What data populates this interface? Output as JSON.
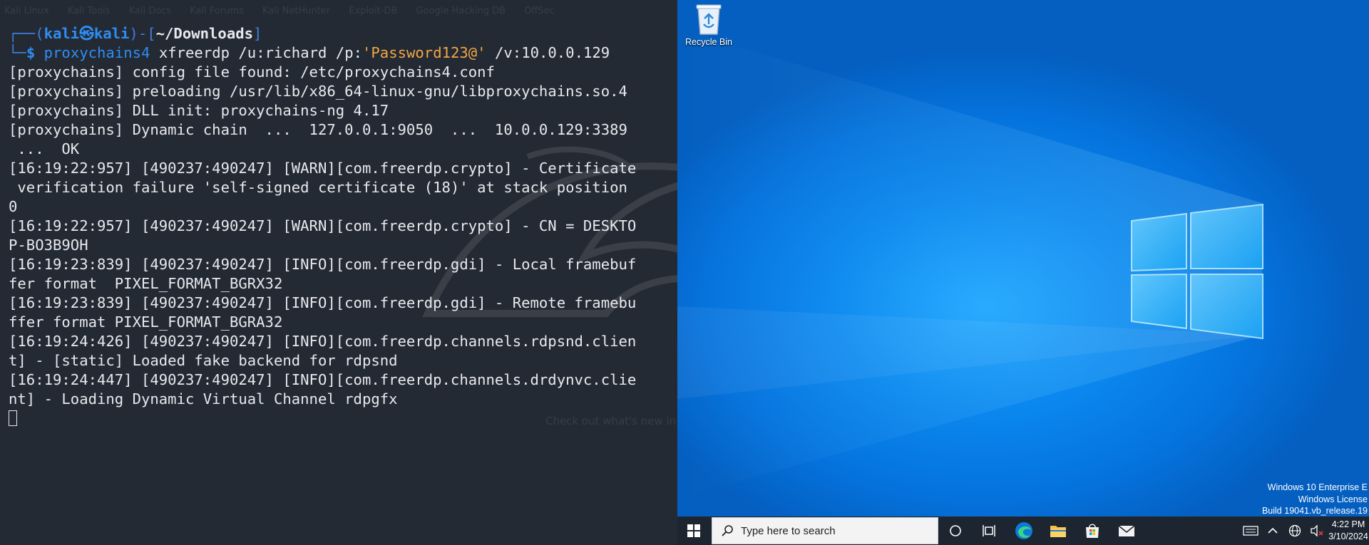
{
  "terminal": {
    "bookmarks": [
      "Kali Linux",
      "Kali Tools",
      "Kali Docs",
      "Kali Forums",
      "Kali NetHunter",
      "Exploit-DB",
      "Google Hacking DB",
      "OffSec"
    ],
    "prompt": {
      "top_open": "┌──(",
      "user": "kali",
      "at": "㉿",
      "host": "kali",
      "mid": ")-[",
      "path": "~/Downloads",
      "close": "]",
      "bottom": "└─",
      "dollar": "$"
    },
    "command": {
      "name": "proxychains4",
      "args_before": " xfreerdp /u:richard /p:",
      "password": "'Password123@'",
      "args_after": " /v:10.0.0.129"
    },
    "output": [
      "[proxychains] config file found: /etc/proxychains4.conf",
      "[proxychains] preloading /usr/lib/x86_64-linux-gnu/libproxychains.so.4",
      "[proxychains] DLL init: proxychains-ng 4.17",
      "[proxychains] Dynamic chain  ...  127.0.0.1:9050  ...  10.0.0.129:3389",
      " ...  OK",
      "[16:19:22:957] [490237:490247] [WARN][com.freerdp.crypto] - Certificate",
      " verification failure 'self-signed certificate (18)' at stack position",
      "0",
      "[16:19:22:957] [490237:490247] [WARN][com.freerdp.crypto] - CN = DESKTO",
      "P-BO3B9OH",
      "[16:19:23:839] [490237:490247] [INFO][com.freerdp.gdi] - Local framebuf",
      "fer format  PIXEL_FORMAT_BGRX32",
      "[16:19:23:839] [490237:490247] [INFO][com.freerdp.gdi] - Remote framebu",
      "ffer format PIXEL_FORMAT_BGRA32",
      "[16:19:24:426] [490237:490247] [INFO][com.freerdp.channels.rdpsnd.clien",
      "t] - [static] Loaded fake backend for rdpsnd",
      "[16:19:24:447] [490237:490247] [INFO][com.freerdp.channels.drdynvc.clie",
      "nt] - Loading Dynamic Virtual Channel rdpgfx"
    ],
    "background_faded_text": "Check out what's new in Kali"
  },
  "desktop": {
    "recycle_bin_label": "Recycle Bin",
    "watermark": [
      "Windows 10 Enterprise E",
      "Windows License",
      "Build 19041.vb_release.19"
    ],
    "taskbar": {
      "search_placeholder": "Type here to search",
      "time": "4:22 PM",
      "date": "3/10/2024"
    }
  },
  "colors": {
    "terminal_bg": "#242a33",
    "prompt_blue": "#2f8df4",
    "string_orange": "#f0a646",
    "desktop_blue": "#0a88ef",
    "taskbar_bg": "#1c2530"
  }
}
